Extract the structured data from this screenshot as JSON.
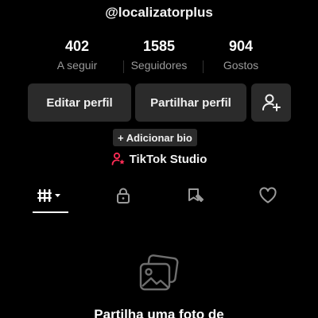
{
  "profile": {
    "username": "@localizatorplus"
  },
  "stats": [
    {
      "value": "402",
      "label": "A seguir"
    },
    {
      "value": "1585",
      "label": "Seguidores"
    },
    {
      "value": "904",
      "label": "Gostos"
    }
  ],
  "actions": {
    "edit_label": "Editar perfil",
    "share_label": "Partilhar perfil"
  },
  "bio": {
    "add_label": "+ Adicionar bio"
  },
  "studio": {
    "label": "TikTok Studio"
  },
  "tabs": [
    {
      "icon": "grid-icon",
      "active": true
    },
    {
      "icon": "lock-icon",
      "active": false
    },
    {
      "icon": "bookmark-icon",
      "active": false
    },
    {
      "icon": "heart-icon",
      "active": false
    }
  ],
  "empty_state": {
    "text": "Partilha uma foto de"
  },
  "colors": {
    "accent": "#fe2c55",
    "background": "#000000",
    "button_bg": "#2b2b2b"
  }
}
